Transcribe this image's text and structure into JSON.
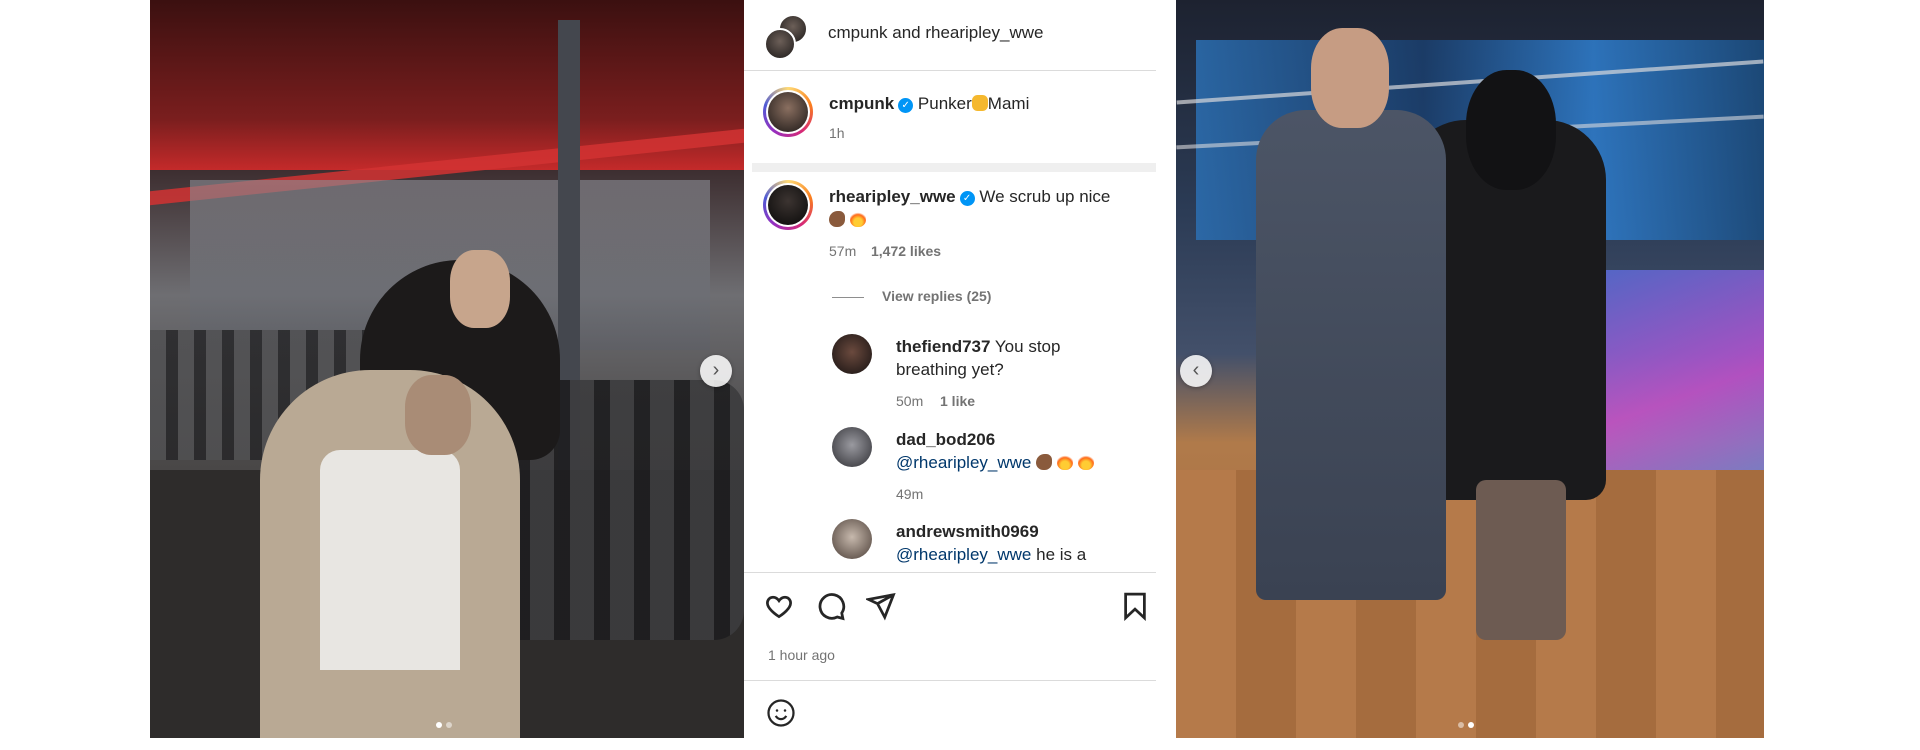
{
  "header": {
    "title": "cmpunk and rhearipley_wwe"
  },
  "caption": {
    "username": "cmpunk",
    "text_before": "Punker",
    "text_after": "Mami",
    "time": "1h"
  },
  "comments": [
    {
      "username": "rhearipley_wwe",
      "text": "We scrub up nice",
      "time": "57m",
      "likes": "1,472 likes",
      "view_replies": "View replies (25)",
      "verified": true
    }
  ],
  "replies": [
    {
      "username": "thefiend737",
      "text_first": "You stop",
      "text_second": "breathing yet?",
      "time": "50m",
      "likes": "1 like"
    },
    {
      "username": "dad_bod206",
      "mention": "@rhearipley_wwe",
      "time": "49m"
    },
    {
      "username": "andrewsmith0969",
      "mention": "@rhearipley_wwe",
      "text": "he is a"
    }
  ],
  "footer": {
    "timestamp": "1 hour ago"
  },
  "icons": {
    "like": "heart-icon",
    "comment": "comment-icon",
    "share": "send-icon",
    "save": "bookmark-icon",
    "emoji": "emoji-icon",
    "verified": "verified-badge-icon"
  },
  "colors": {
    "verified": "#0095f6",
    "text": "#262626",
    "muted": "#737373"
  }
}
